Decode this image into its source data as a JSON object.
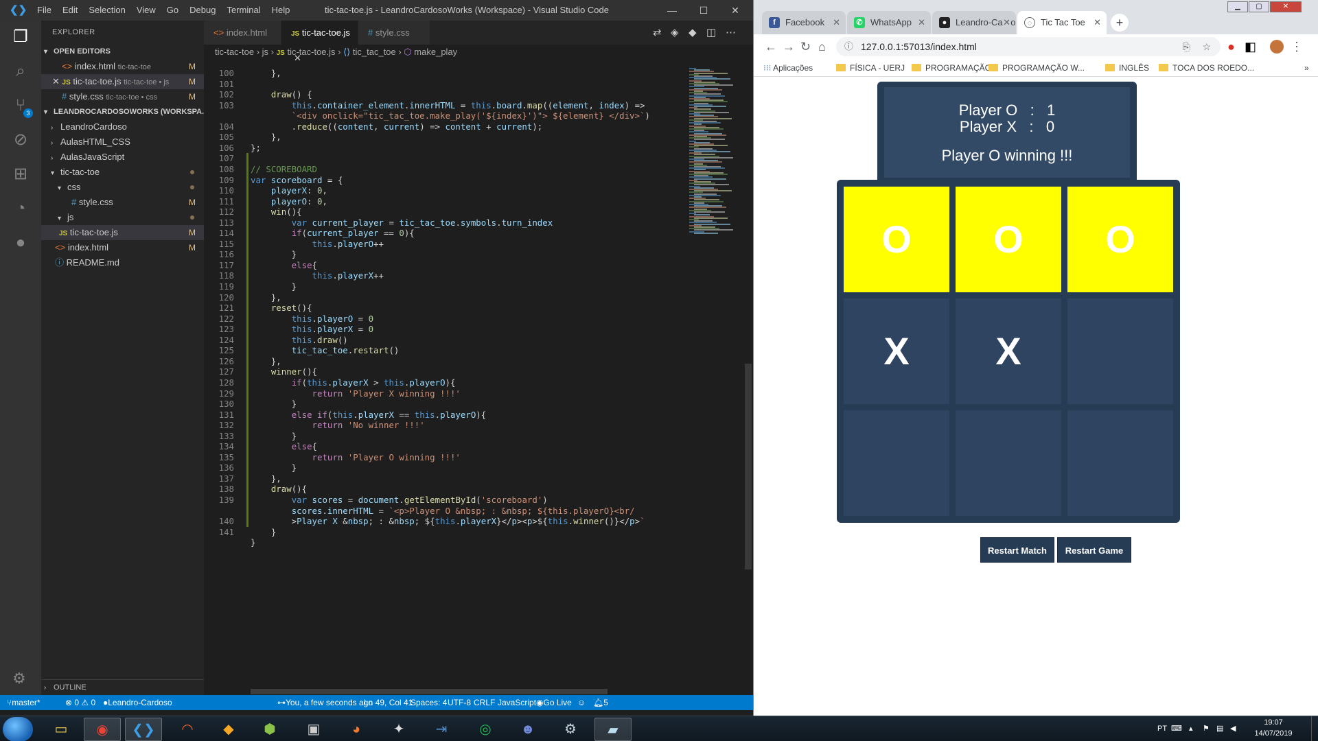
{
  "vscode": {
    "menus": [
      "File",
      "Edit",
      "Selection",
      "View",
      "Go",
      "Debug",
      "Terminal",
      "Help"
    ],
    "window_title": "tic-tac-toe.js - LeandroCardosoWorks (Workspace) - Visual Studio Code",
    "explorer": {
      "title": "EXPLORER",
      "open_editors_title": "OPEN EDITORS",
      "open_editors": [
        {
          "name": "index.html",
          "folder": "tic-tac-toe",
          "flag": "M"
        },
        {
          "name": "tic-tac-toe.js",
          "folder": "tic-tac-toe • js",
          "flag": "M"
        },
        {
          "name": "style.css",
          "folder": "tic-tac-toe • css",
          "flag": "M"
        }
      ],
      "workspace_title": "LEANDROCARDOSOWORKS (WORKSPA...",
      "tree": [
        "LeandroCardoso",
        "AulasHTML_CSS",
        "AulasJavaScript",
        "tic-tac-toe",
        "css",
        "style.css",
        "js",
        "tic-tac-toe.js",
        "index.html",
        "README.md"
      ],
      "tree_flags": {
        "style_css": "M",
        "tic_tac_toe_js": "M",
        "index_html": "M"
      },
      "outline_title": "OUTLINE"
    },
    "tabs": [
      "index.html",
      "tic-tac-toe.js",
      "style.css"
    ],
    "active_tab": "tic-tac-toe.js",
    "breadcrumb": [
      "tic-tac-toe",
      "js",
      "tic-tac-toe.js",
      "tic_tac_toe",
      "make_play"
    ],
    "line_numbers": [
      "100",
      "101",
      "102",
      "103",
      "",
      "104",
      "105",
      "106",
      "107",
      "108",
      "109",
      "110",
      "111",
      "112",
      "113",
      "114",
      "115",
      "116",
      "117",
      "118",
      "119",
      "120",
      "121",
      "122",
      "123",
      "124",
      "125",
      "126",
      "127",
      "128",
      "129",
      "130",
      "131",
      "132",
      "133",
      "134",
      "135",
      "136",
      "137",
      "138",
      "139",
      "",
      "140",
      "141"
    ],
    "code_lines": [
      "    },",
      "",
      "    draw() {",
      "        this.container_element.innerHTML = this.board.map((element, index) =>",
      "        `<div onclick=\"tic_tac_toe.make_play('${index}')\"> ${element} </div>`)",
      "        .reduce((content, current) => content + current);",
      "    },",
      "};",
      "",
      "// SCOREBOARD",
      "var scoreboard = {",
      "    playerX: 0,",
      "    playerO: 0,",
      "    win(){",
      "        var current_player = tic_tac_toe.symbols.turn_index",
      "        if(current_player == 0){",
      "            this.playerO++",
      "        }",
      "        else{",
      "            this.playerX++",
      "        }",
      "    },",
      "    reset(){",
      "        this.playerO = 0",
      "        this.playerX = 0",
      "        this.draw()",
      "        tic_tac_toe.restart()",
      "    },",
      "    winner(){",
      "        if(this.playerX > this.playerO){",
      "            return 'Player X winning !!!'",
      "        }",
      "        else if(this.playerX == this.playerO){",
      "            return 'No winner !!!'",
      "        }",
      "        else{",
      "            return 'Player O winning !!!'",
      "        }",
      "    },",
      "    draw(){",
      "        var scores = document.getElementById('scoreboard')",
      "        scores.innerHTML = `<p>Player O &nbsp; : &nbsp; ${this.playerO}<br/",
      "        >Player X &nbsp; : &nbsp; ${this.playerX}</p><p>${this.winner()}</p>`",
      "    }",
      "}"
    ],
    "status": {
      "branch": "master*",
      "problems": "⊗ 0 ⚠ 0",
      "github": "Leandro-Cardoso",
      "blame": "You, a few seconds ago",
      "position": "Ln 49, Col 41",
      "spaces": "Spaces: 4",
      "encoding": "UTF-8",
      "eol": "CRLF",
      "language": "JavaScript",
      "golive": "Go Live",
      "notifications": "5"
    },
    "scm_badge": "3"
  },
  "chrome": {
    "tabs": [
      {
        "label": "Facebook",
        "icon": "facebook-icon",
        "color": "#3b5998",
        "glyph": "f"
      },
      {
        "label": "WhatsApp",
        "icon": "whatsapp-icon",
        "color": "#25d366",
        "glyph": "✆"
      },
      {
        "label": "Leandro-Cardoso",
        "icon": "github-icon",
        "color": "#222222",
        "glyph": "●"
      },
      {
        "label": "Tic Tac Toe",
        "icon": "globe-icon",
        "color": "#5f6368",
        "glyph": "◌"
      }
    ],
    "url": "127.0.0.1:57013/index.html",
    "bookmarks": [
      "Aplicações",
      "FÍSICA - UERJ",
      "PROGRAMAÇÃO",
      "PROGRAMAÇÃO W...",
      "INGLÊS",
      "TOCA DOS ROEDO..."
    ],
    "page": {
      "score_o": "Player O   :   1",
      "score_x": "Player X   :   0",
      "winner": "Player O winning !!!",
      "cells": [
        "O",
        "O",
        "O",
        "X",
        "X",
        "",
        "",
        "",
        ""
      ],
      "winning_cells": [
        0,
        1,
        2
      ],
      "restart_match": "Restart Match",
      "restart_game": "Restart Game"
    }
  },
  "taskbar": {
    "language": "PT",
    "time": "19:07",
    "date": "14/07/2019"
  },
  "colors": {
    "vscode_bg": "#1e1e1e",
    "statusbar": "#007acc",
    "board_bg": "#263b54",
    "cell_bg": "#2f4461",
    "win_cell": "#ffff00"
  }
}
